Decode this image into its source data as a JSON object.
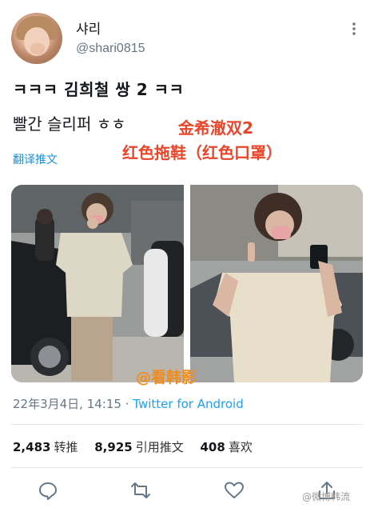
{
  "user": {
    "display_name": "샤리",
    "handle": "@shari0815"
  },
  "tweet": {
    "line1": "ㅋㅋㅋ 김희철 쌍 2 ㅋㅋ",
    "line2": "빨간 슬리퍼 ㅎㅎ",
    "translate_label": "翻译推文"
  },
  "overlay": {
    "caption1": "金希澈双2",
    "caption2": "红色拖鞋（红色口罩）",
    "watermark": "@看韩影"
  },
  "meta": {
    "timestamp": "22年3月4日, 14:15",
    "separator": "·",
    "app": "Twitter for Android"
  },
  "stats": {
    "retweets_value": "2,483",
    "retweets_label": "转推",
    "quotes_value": "8,925",
    "quotes_label": "引用推文",
    "likes_value": "408",
    "likes_label": "喜欢"
  },
  "corner_watermark": "@微博韩流",
  "icons": [
    "more-vertical-icon",
    "reply-icon",
    "retweet-icon",
    "like-icon",
    "share-icon"
  ],
  "colors": {
    "overlay_text": "#e8452a",
    "link": "#1da1f2",
    "watermark": "#f08c1e"
  }
}
